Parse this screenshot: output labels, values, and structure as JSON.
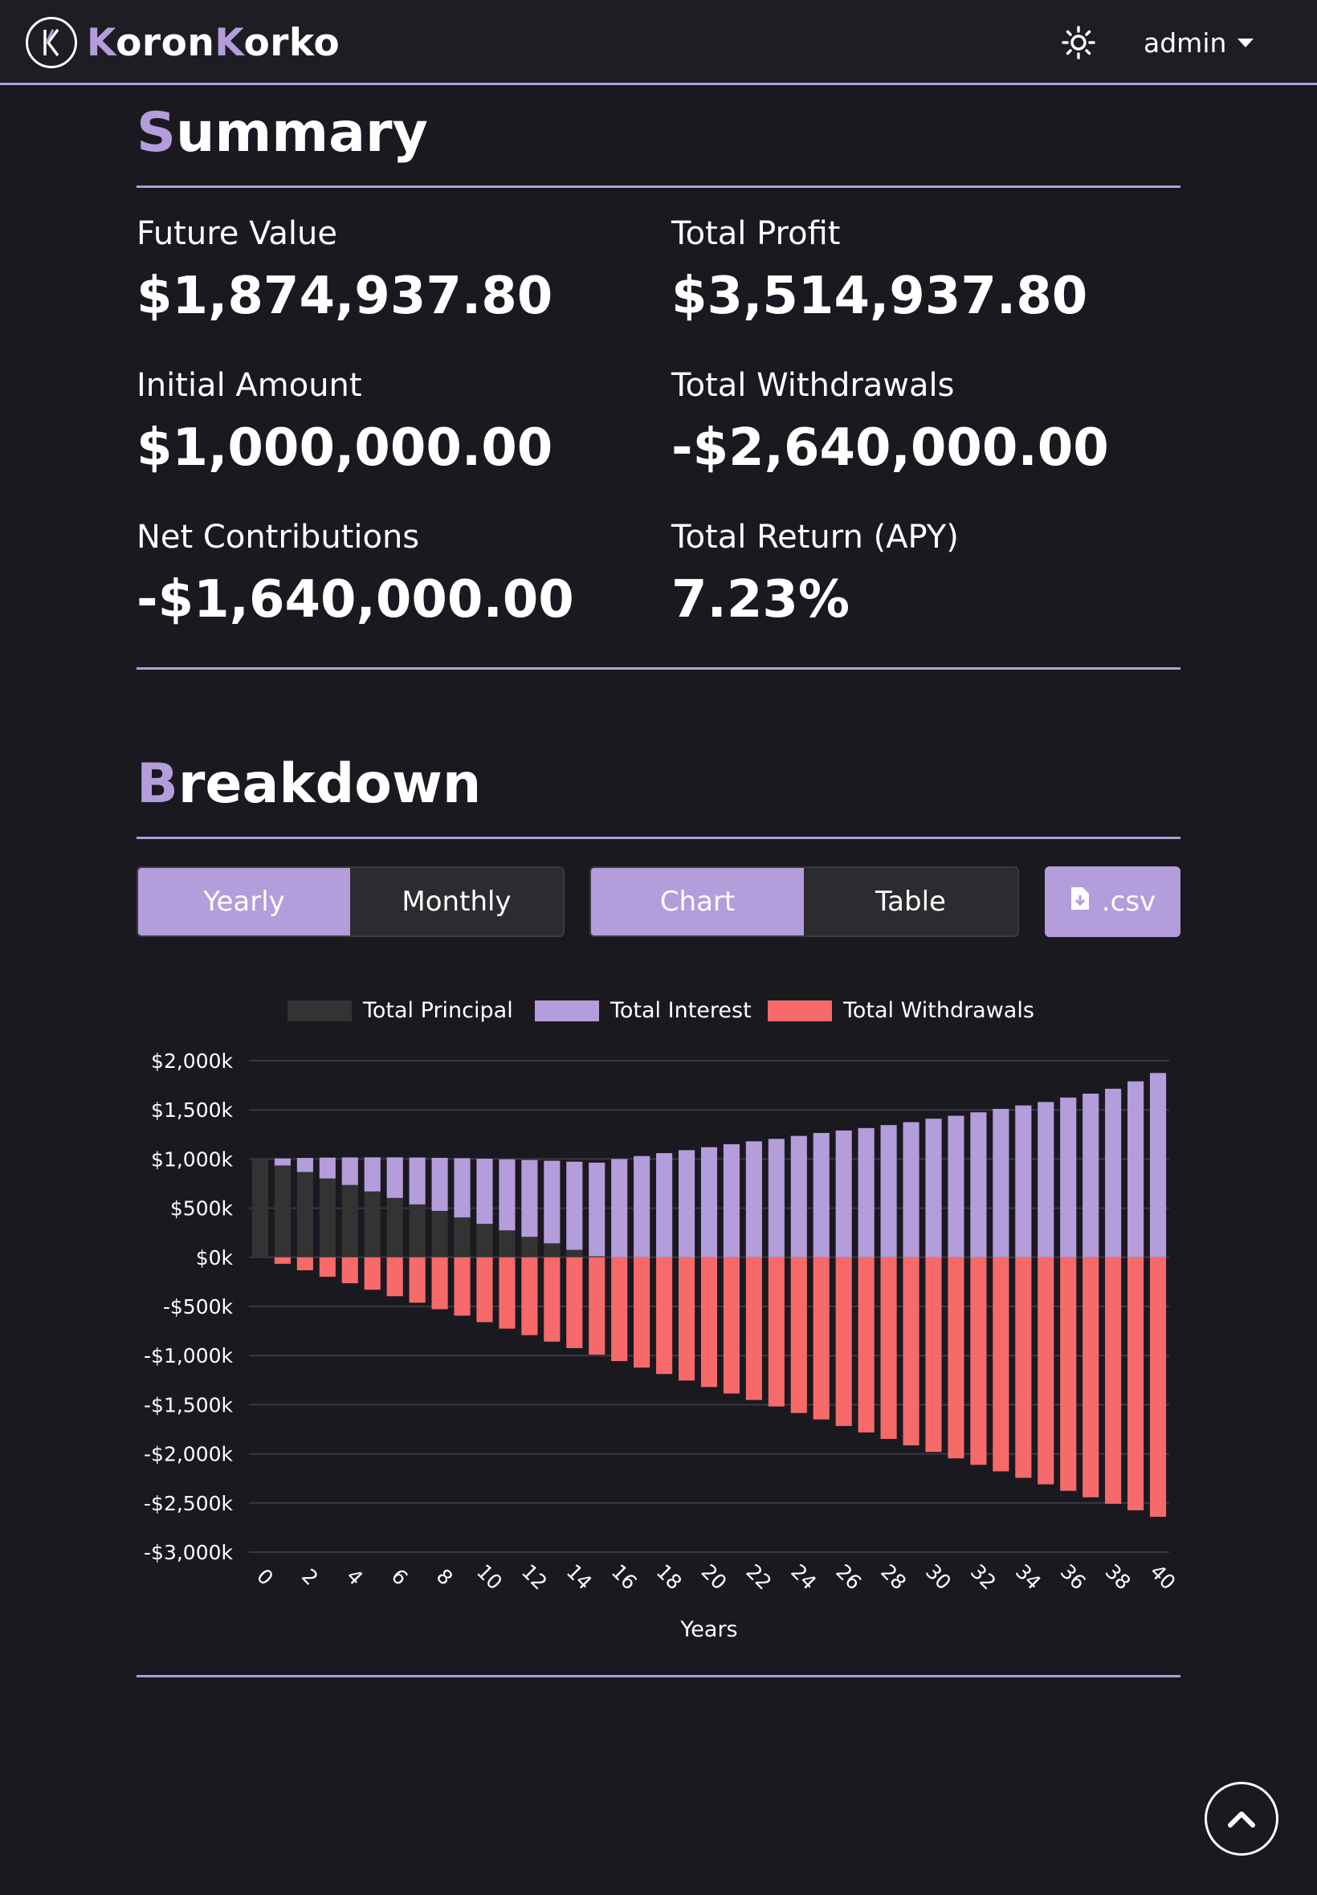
{
  "brand": {
    "name_first": "K",
    "name_part1": "oron",
    "name_second": "K",
    "name_part2": "orko"
  },
  "user_menu": {
    "label": "admin"
  },
  "summary": {
    "title_first": "S",
    "title_rest": "ummary",
    "metrics": [
      {
        "label": "Future Value",
        "value": "$1,874,937.80"
      },
      {
        "label": "Total Profit",
        "value": "$3,514,937.80"
      },
      {
        "label": "Initial Amount",
        "value": "$1,000,000.00"
      },
      {
        "label": "Total Withdrawals",
        "value": "-$2,640,000.00"
      },
      {
        "label": "Net Contributions",
        "value": "-$1,640,000.00"
      },
      {
        "label": "Total Return (APY)",
        "value": "7.23%"
      }
    ]
  },
  "breakdown": {
    "title_first": "B",
    "title_rest": "reakdown",
    "period_toggle": {
      "yearly": "Yearly",
      "monthly": "Monthly",
      "selected": "Yearly"
    },
    "view_toggle": {
      "chart": "Chart",
      "table": "Table",
      "selected": "Chart"
    },
    "export_label": ".csv"
  },
  "colors": {
    "accent": "#b39ddb",
    "principal": "#333333",
    "interest": "#b39ddb",
    "withdrawals": "#f66a6a",
    "background": "#1b1920"
  },
  "chart_data": {
    "type": "bar",
    "stacked": true,
    "xlabel": "Years",
    "ylabel": "",
    "ylim": [
      -3000,
      2000
    ],
    "y_ticks": [
      "$2,000k",
      "$1,500k",
      "$1,000k",
      "$500k",
      "$0k",
      "-$500k",
      "-$1,000k",
      "-$1,500k",
      "-$2,000k",
      "-$2,500k",
      "-$3,000k"
    ],
    "x_tick_labels": [
      "0",
      "2",
      "4",
      "6",
      "8",
      "10",
      "12",
      "14",
      "16",
      "18",
      "20",
      "22",
      "24",
      "26",
      "28",
      "30",
      "32",
      "34",
      "36",
      "38",
      "40"
    ],
    "legend_position": "top-center",
    "grid": true,
    "categories": [
      0,
      1,
      2,
      3,
      4,
      5,
      6,
      7,
      8,
      9,
      10,
      11,
      12,
      13,
      14,
      15,
      16,
      17,
      18,
      19,
      20,
      21,
      22,
      23,
      24,
      25,
      26,
      27,
      28,
      29,
      30,
      31,
      32,
      33,
      34,
      35,
      36,
      37,
      38,
      39,
      40
    ],
    "series": [
      {
        "name": "Total Principal",
        "values": [
          1000,
          934,
          868,
          802,
          736,
          670,
          604,
          538,
          472,
          406,
          340,
          274,
          208,
          142,
          76,
          10,
          0,
          0,
          0,
          0,
          0,
          0,
          0,
          0,
          0,
          0,
          0,
          0,
          0,
          0,
          0,
          0,
          0,
          0,
          0,
          0,
          0,
          0,
          0,
          0,
          0
        ]
      },
      {
        "name": "Total Interest",
        "values": [
          0,
          72,
          143,
          212,
          280,
          347,
          413,
          477,
          540,
          602,
          663,
          723,
          782,
          840,
          897,
          953,
          1000,
          1030,
          1060,
          1090,
          1120,
          1150,
          1180,
          1205,
          1235,
          1265,
          1290,
          1315,
          1345,
          1375,
          1410,
          1440,
          1475,
          1510,
          1545,
          1580,
          1625,
          1665,
          1715,
          1790,
          1875
        ]
      },
      {
        "name": "Total Withdrawals",
        "values": [
          0,
          -66,
          -132,
          -198,
          -264,
          -330,
          -396,
          -462,
          -528,
          -594,
          -660,
          -726,
          -792,
          -858,
          -924,
          -990,
          -1056,
          -1122,
          -1188,
          -1254,
          -1320,
          -1386,
          -1452,
          -1518,
          -1584,
          -1650,
          -1716,
          -1782,
          -1848,
          -1914,
          -1980,
          -2046,
          -2112,
          -2178,
          -2244,
          -2310,
          -2376,
          -2442,
          -2508,
          -2574,
          -2640
        ]
      }
    ]
  }
}
